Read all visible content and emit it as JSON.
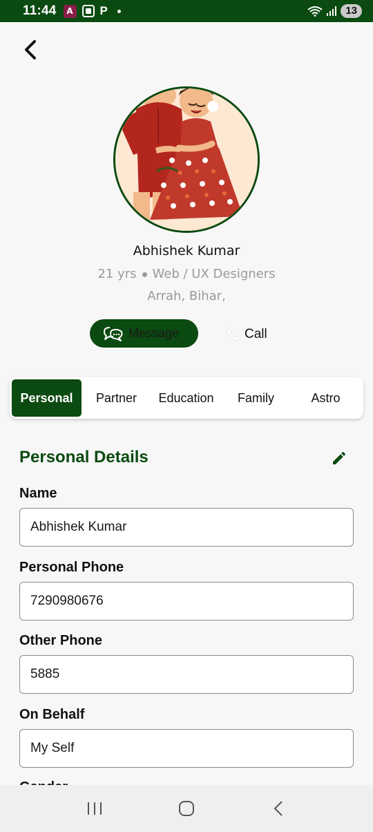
{
  "status_bar": {
    "time": "11:44",
    "app_icon_letter": "A",
    "p_icon": "P",
    "battery": "13"
  },
  "profile": {
    "name": "Abhishek Kumar",
    "age": "21 yrs",
    "profession": "Web / UX Designers",
    "location": "Arrah, Bihar,"
  },
  "actions": {
    "message_label": "Message",
    "call_label": "Call"
  },
  "tabs": [
    {
      "label": "Personal",
      "active": true
    },
    {
      "label": "Partner",
      "active": false
    },
    {
      "label": "Education",
      "active": false
    },
    {
      "label": "Family",
      "active": false
    },
    {
      "label": "Astro",
      "active": false
    }
  ],
  "section": {
    "title": "Personal Details"
  },
  "fields": [
    {
      "label": "Name",
      "value": "Abhishek Kumar"
    },
    {
      "label": "Personal Phone",
      "value": "7290980676"
    },
    {
      "label": "Other Phone",
      "value": "5885"
    },
    {
      "label": "On Behalf",
      "value": "My Self"
    }
  ],
  "next_field_label": "Gender",
  "colors": {
    "primary": "#0b4a10",
    "background": "#f7f7f7",
    "muted_text": "#9a9a9a"
  },
  "icons": {
    "back": "back-arrow-icon",
    "message": "chat-bubbles-icon",
    "call": "phone-icon",
    "edit": "pencil-icon",
    "nav_recents": "recents-icon",
    "nav_home": "home-icon",
    "nav_back": "nav-back-icon"
  }
}
